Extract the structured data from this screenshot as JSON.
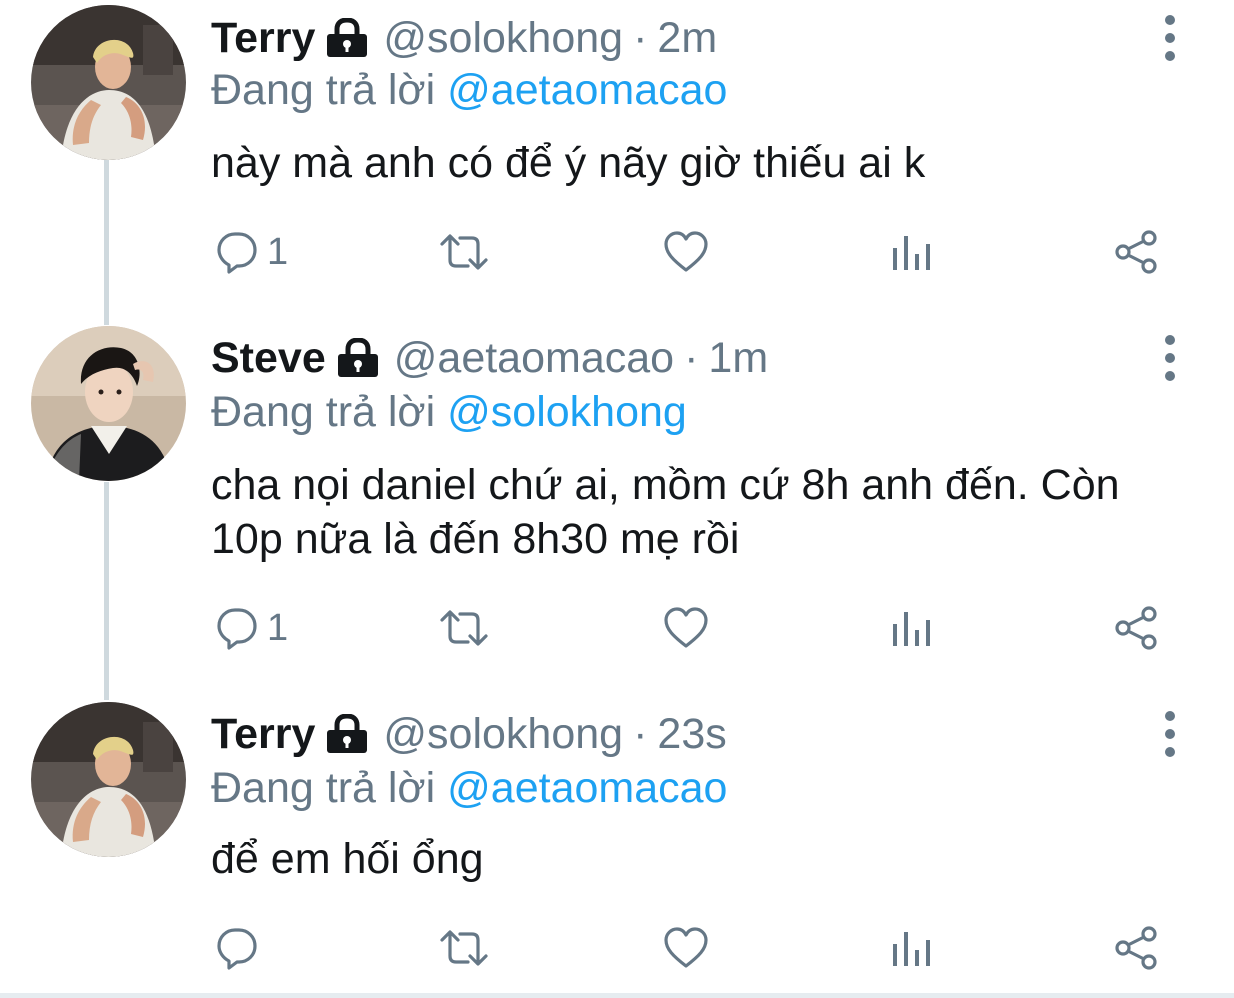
{
  "colors": {
    "text": "#14171a",
    "secondary": "#657786",
    "mention": "#1da1f2",
    "thread_line": "#cfd9de"
  },
  "tweets": [
    {
      "name": "Terry",
      "handle": "@solokhong",
      "separator": "·",
      "time": "2m",
      "reply_prefix": "Đang trả lời",
      "reply_mention": "@aetaomacao",
      "text": "này mà anh có để ý nãy giờ thiếu ai k",
      "reply_count": "1",
      "avatar": "terry-avatar"
    },
    {
      "name": "Steve",
      "handle": "@aetaomacao",
      "separator": "·",
      "time": "1m",
      "reply_prefix": "Đang trả lời",
      "reply_mention": "@solokhong",
      "text": "cha nọi daniel chứ ai, mồm cứ 8h anh đến. Còn 10p nữa là đến 8h30 mẹ rồi",
      "reply_count": "1",
      "avatar": "steve-avatar"
    },
    {
      "name": "Terry",
      "handle": "@solokhong",
      "separator": "·",
      "time": "23s",
      "reply_prefix": "Đang trả lời",
      "reply_mention": "@aetaomacao",
      "text": "để em hối ổng",
      "reply_count": "",
      "avatar": "terry-avatar"
    }
  ],
  "icons": {
    "lock": "lock-icon",
    "more": "more-vertical-icon",
    "reply": "reply-bubble-icon",
    "retweet": "retweet-icon",
    "like": "heart-icon",
    "analytics": "analytics-icon",
    "share": "share-icon"
  }
}
